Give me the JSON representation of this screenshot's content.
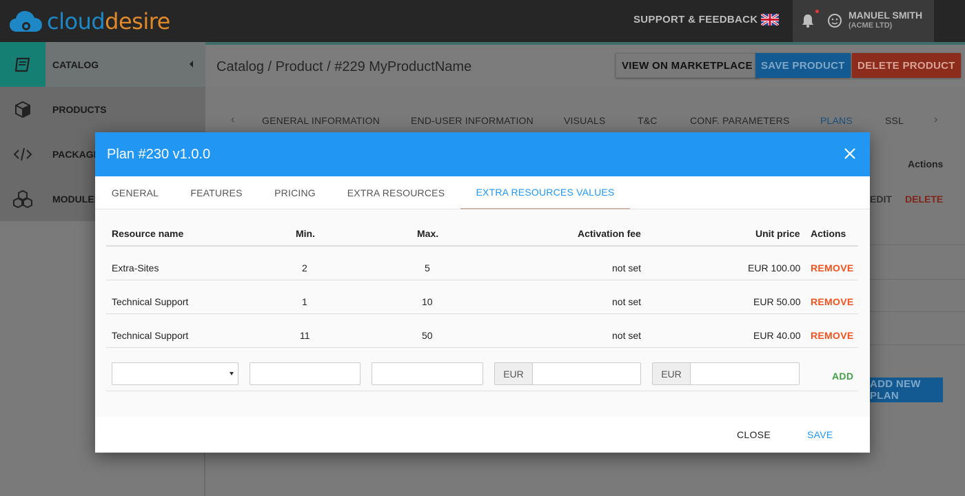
{
  "app": {
    "logo_part1": "cloud",
    "logo_part2": "esire",
    "logo_d": "d",
    "support_link": "SUPPORT & FEEDBACK",
    "user_name": "MANUEL SMITH",
    "user_company": "(ACME LTD)"
  },
  "sidebar": {
    "items": [
      {
        "label": "CATALOG",
        "icon": "book-icon"
      },
      {
        "label": "PRODUCTS",
        "icon": "cube-icon"
      },
      {
        "label": "PACKAGES",
        "icon": "code-icon"
      },
      {
        "label": "MODULES",
        "icon": "cubes-icon"
      }
    ]
  },
  "page": {
    "breadcrumb": "Catalog / Product / #229 MyProductName",
    "view_button": "VIEW ON MARKETPLACE",
    "save_button": "SAVE PRODUCT",
    "delete_button": "DELETE PRODUCT",
    "tabs": [
      "GENERAL INFORMATION",
      "END-USER INFORMATION",
      "VISUALS",
      "T&C",
      "CONF. PARAMETERS",
      "PLANS",
      "SSL"
    ],
    "active_tab": "PLANS",
    "actions_header": "Actions",
    "edit_label": "EDIT",
    "delete_label": "DELETE",
    "add_plan_label": "ADD NEW PLAN"
  },
  "modal": {
    "title": "Plan #230 v1.0.0",
    "tabs": [
      "GENERAL",
      "FEATURES",
      "PRICING",
      "EXTRA RESOURCES",
      "EXTRA RESOURCES VALUES"
    ],
    "active_tab": "EXTRA RESOURCES VALUES",
    "columns": {
      "name": "Resource name",
      "min": "Min.",
      "max": "Max.",
      "fee": "Activation fee",
      "price": "Unit price",
      "actions": "Actions"
    },
    "rows": [
      {
        "name": "Extra-Sites",
        "min": "2",
        "max": "5",
        "fee": "not set",
        "price": "EUR 100.00",
        "action": "REMOVE"
      },
      {
        "name": "Technical Support",
        "min": "1",
        "max": "10",
        "fee": "not set",
        "price": "EUR 50.00",
        "action": "REMOVE"
      },
      {
        "name": "Technical Support",
        "min": "11",
        "max": "50",
        "fee": "not set",
        "price": "EUR 40.00",
        "action": "REMOVE"
      }
    ],
    "form": {
      "resource_select": "",
      "min_value": "",
      "max_value": "",
      "fee_currency": "EUR",
      "fee_value": "",
      "price_currency": "EUR",
      "price_value": "",
      "add_label": "ADD"
    },
    "footer": {
      "close_label": "CLOSE",
      "save_label": "SAVE"
    }
  },
  "colors": {
    "primary": "#2196f3",
    "danger": "#f4511e",
    "success": "#43a047",
    "teal": "#167f74"
  }
}
